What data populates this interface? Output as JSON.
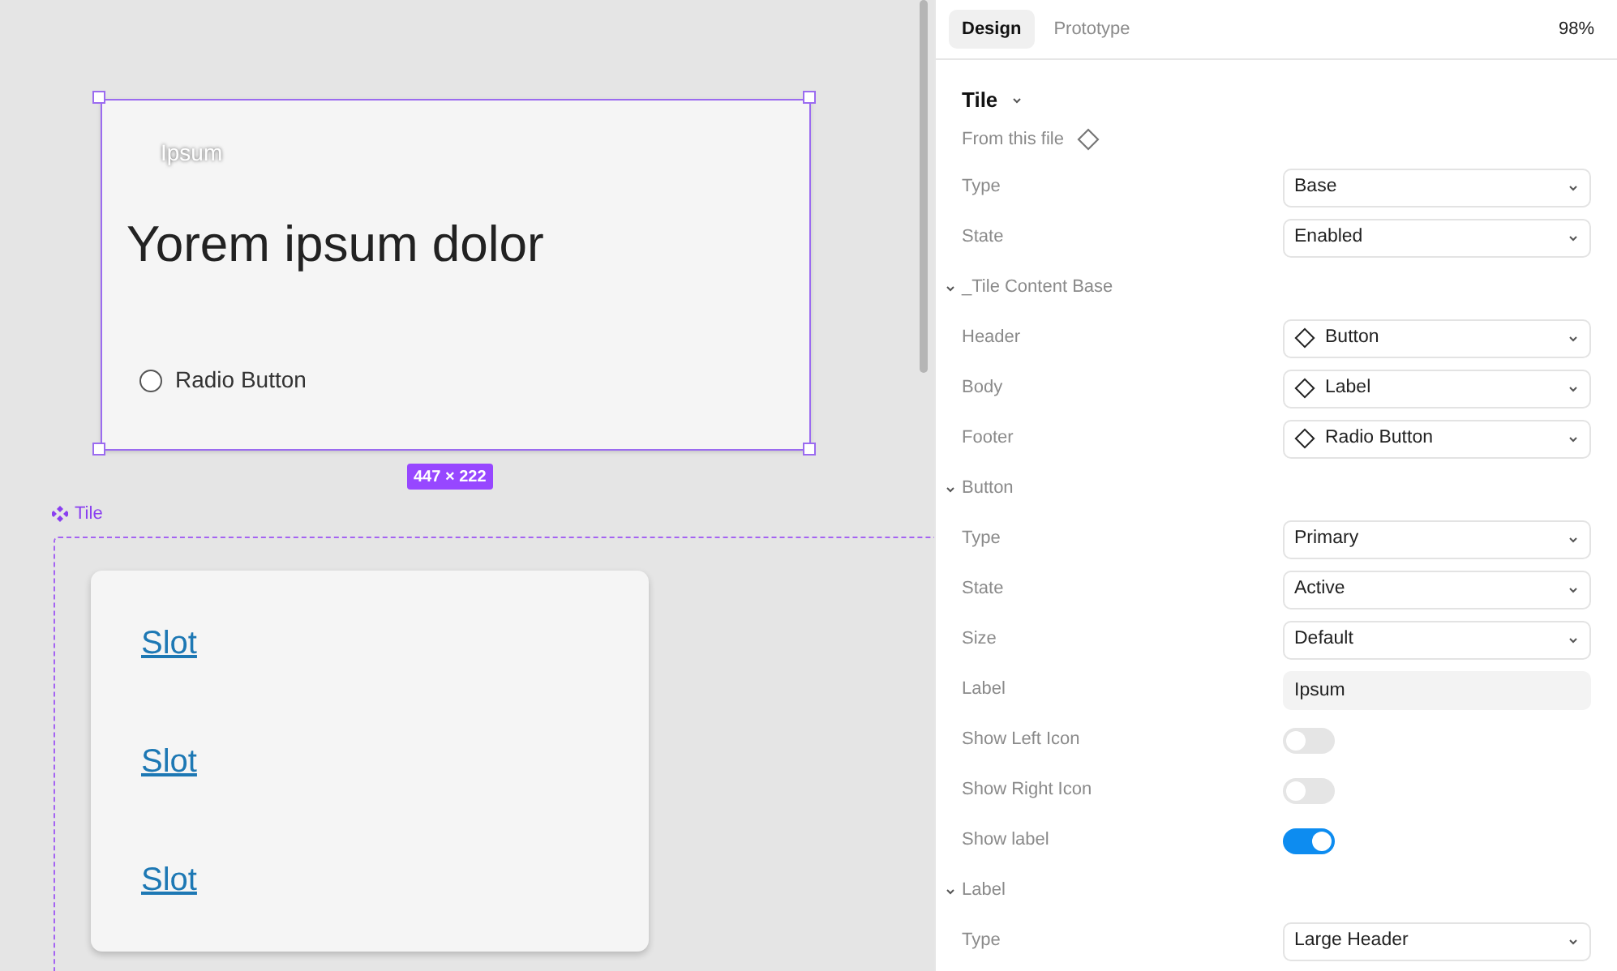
{
  "canvas": {
    "selected_tile": {
      "button_label": "Ipsum",
      "heading": "Yorem ipsum dolor",
      "radio": {
        "label": "Radio Button",
        "checked": false
      },
      "size_badge": "447 × 222"
    },
    "component_label": "Tile",
    "slots": [
      "Slot",
      "Slot",
      "Slot"
    ]
  },
  "panel": {
    "tabs": [
      {
        "label": "Design",
        "selected": true
      },
      {
        "label": "Prototype",
        "selected": false
      }
    ],
    "zoom": "98%",
    "component": {
      "name": "Tile",
      "source": "From this file"
    },
    "sections": [
      {
        "rows": [
          {
            "kind": "select",
            "label": "Type",
            "value": "Base"
          },
          {
            "kind": "select",
            "label": "State",
            "value": "Enabled"
          }
        ]
      },
      {
        "title": "_Tile Content Base",
        "rows": [
          {
            "kind": "instance",
            "label": "Header",
            "value": "Button"
          },
          {
            "kind": "instance",
            "label": "Body",
            "value": "Label"
          },
          {
            "kind": "instance",
            "label": "Footer",
            "value": "Radio Button"
          }
        ]
      },
      {
        "title": "Button",
        "rows": [
          {
            "kind": "select",
            "label": "Type",
            "value": "Primary"
          },
          {
            "kind": "select",
            "label": "State",
            "value": "Active"
          },
          {
            "kind": "select",
            "label": "Size",
            "value": "Default"
          },
          {
            "kind": "text",
            "label": "Label",
            "value": "Ipsum"
          },
          {
            "kind": "toggle",
            "label": "Show Left Icon",
            "on": false
          },
          {
            "kind": "toggle",
            "label": "Show Right Icon",
            "on": false
          },
          {
            "kind": "toggle",
            "label": "Show label",
            "on": true
          }
        ]
      },
      {
        "title": "Label",
        "rows": [
          {
            "kind": "select",
            "label": "Type",
            "value": "Large Header"
          }
        ]
      }
    ]
  }
}
